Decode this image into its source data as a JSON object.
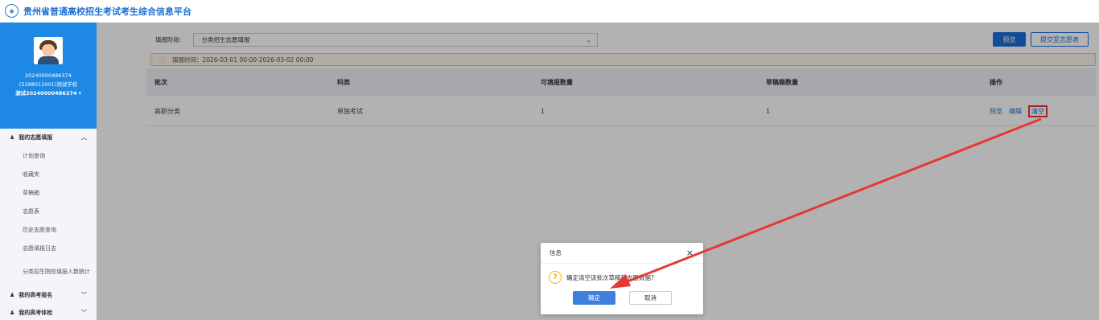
{
  "header": {
    "title": "贵州省普通高校招生考试考生综合信息平台",
    "logo_icon": "university-logo-icon"
  },
  "profile": {
    "id": "20240000486374",
    "school": "(5298011001)测试学校",
    "user": "测试20240000486374 ▾"
  },
  "sidebar": {
    "section1": {
      "label": "我的志愿填报",
      "expanded": true
    },
    "items": [
      "计划查询",
      "收藏夹",
      "草稿箱",
      "志愿表",
      "历史志愿查询",
      "志愿填报日志",
      "分类招生院校填报人数统计"
    ],
    "section2": {
      "label": "我的高考报名"
    },
    "section3": {
      "label": "我的高考体检"
    }
  },
  "toolbar": {
    "stage_label": "填报阶段:",
    "stage_value": "分类招生志愿填报",
    "preview_button": "预览",
    "submit_button": "提交至志愿表"
  },
  "notice": {
    "text": "填报时间：2026-03-01 00:00-2026-03-02 00:00"
  },
  "table": {
    "headers": [
      "批次",
      "科类",
      "可填报数量",
      "草稿箱数量",
      "操作"
    ],
    "rows": [
      {
        "batch": "高职分类",
        "category": "单独考试",
        "allowed": "1",
        "draft": "1",
        "ops": [
          "预览",
          "编辑",
          "清空"
        ]
      }
    ]
  },
  "dialog": {
    "title": "信息",
    "message": "确定清空该批次草稿箱志愿数据?",
    "ok": "确定",
    "cancel": "取消"
  },
  "colors": {
    "accent": "#1e6fd9",
    "sidebar_profile": "#1e88e5",
    "annotation": "#e53935"
  }
}
